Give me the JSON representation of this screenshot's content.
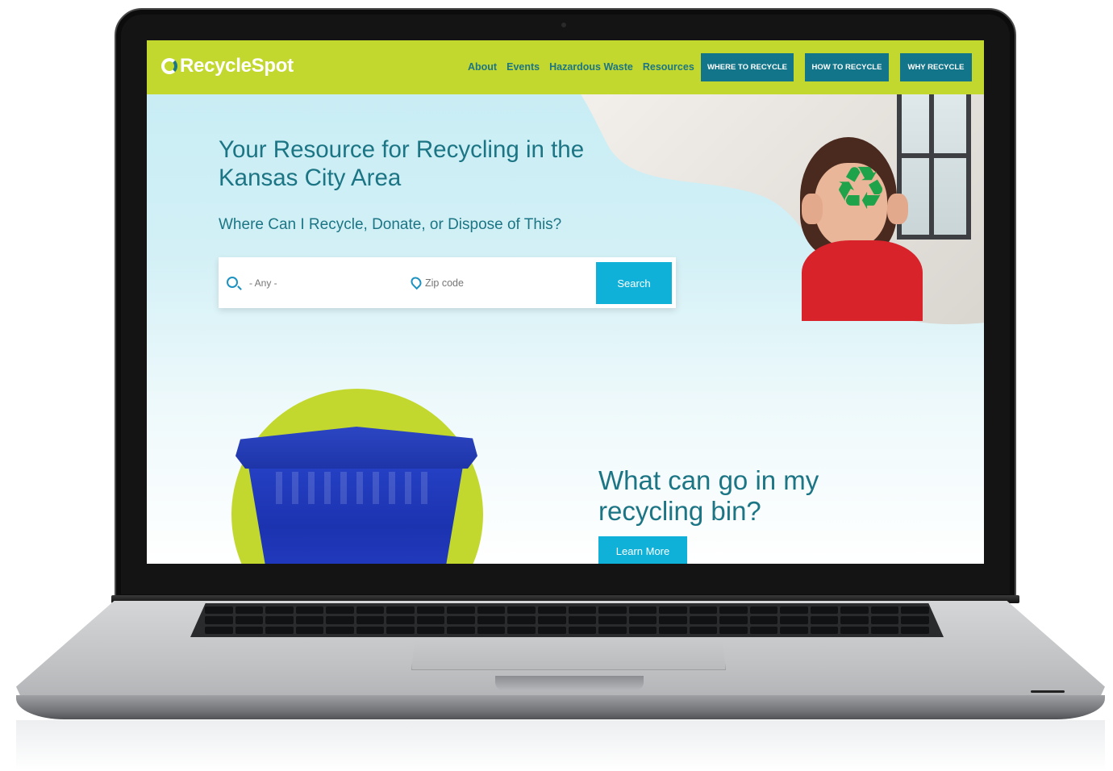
{
  "site": {
    "logo_text": "RecycleSpot"
  },
  "nav": {
    "links": [
      "About",
      "Events",
      "Hazardous Waste",
      "Resources"
    ],
    "buttons": [
      "WHERE TO RECYCLE",
      "HOW TO RECYCLE",
      "WHY RECYCLE"
    ]
  },
  "hero": {
    "title": "Your Resource for Recycling in the Kansas City Area",
    "subtitle": "Where Can I Recycle, Donate, or Dispose of This?"
  },
  "search": {
    "item_placeholder": "- Any -",
    "zip_placeholder": "Zip code",
    "button_label": "Search"
  },
  "bin_section": {
    "title": "What can go in my recycling bin?",
    "button_label": "Learn More"
  },
  "colors": {
    "nav_green": "#c3d82e",
    "brand_teal": "#1c7584",
    "button_teal": "#12758a",
    "accent_cyan": "#0fb1d8",
    "bin_blue": "#2540c4"
  }
}
